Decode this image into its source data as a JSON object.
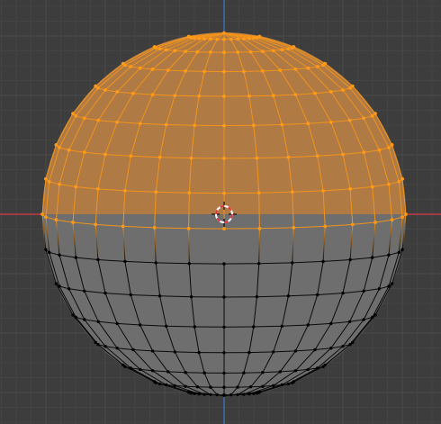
{
  "viewport": {
    "view": "front-orthographic",
    "mode": "edit-mode-vertex-select",
    "object": "uv-sphere",
    "selection": "upper-hemisphere"
  },
  "mesh": {
    "segments": 32,
    "rings": 16
  },
  "colors": {
    "background": "#3d3d3d",
    "grid_minor": "#444444",
    "grid_major": "#4b4b4b",
    "axis_x": "#c23a47",
    "axis_z": "#3f6cb4",
    "face_unselected": "#6e6e6e",
    "face_selected": "#b07a45",
    "edge_unselected": "#0a0a0a",
    "edge_selected": "#f0931c",
    "vertex_unselected": "#000000",
    "vertex_selected": "#ff9a18",
    "cursor_red": "#e0323c",
    "cursor_white": "#ffffff",
    "cursor_cross": "#111111"
  }
}
